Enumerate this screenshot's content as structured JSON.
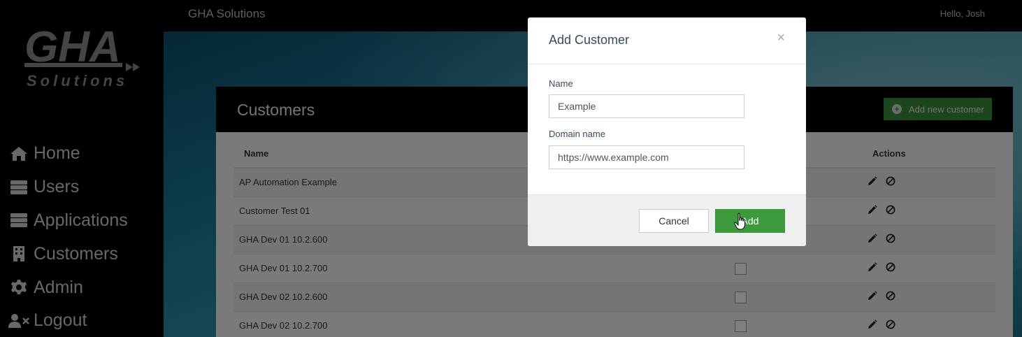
{
  "topbar": {
    "brand": "GHA Solutions",
    "greeting": "Hello, Josh"
  },
  "logo": {
    "alt": "GHA Solutions logo"
  },
  "sidebar": {
    "items": [
      {
        "label": "Home",
        "icon": "home-icon"
      },
      {
        "label": "Users",
        "icon": "server-icon"
      },
      {
        "label": "Applications",
        "icon": "server-icon"
      },
      {
        "label": "Customers",
        "icon": "building-icon"
      },
      {
        "label": "Admin",
        "icon": "gear-icon"
      },
      {
        "label": "Logout",
        "icon": "user-x-icon"
      }
    ]
  },
  "card": {
    "title": "Customers",
    "add_new_label": "Add new customer",
    "columns": {
      "name": "Name",
      "actions": "Actions"
    },
    "rows": [
      {
        "name": "AP Automation Example",
        "checkbox": false
      },
      {
        "name": "Customer Test 01",
        "checkbox": false
      },
      {
        "name": "GHA Dev 01 10.2.600",
        "checkbox": false
      },
      {
        "name": "GHA Dev 01 10.2.700",
        "checkbox": true
      },
      {
        "name": "GHA Dev 02 10.2.600",
        "checkbox": true
      },
      {
        "name": "GHA Dev 02 10.2.700",
        "checkbox": true
      }
    ]
  },
  "modal": {
    "title": "Add Customer",
    "close": "×",
    "name_label": "Name",
    "name_value": "Example",
    "domain_label": "Domain name",
    "domain_value": "https://www.example.com",
    "cancel_label": "Cancel",
    "add_label": "Add"
  },
  "colors": {
    "accent_green": "#3c9a3c",
    "sidebar_bg": "#000000"
  }
}
